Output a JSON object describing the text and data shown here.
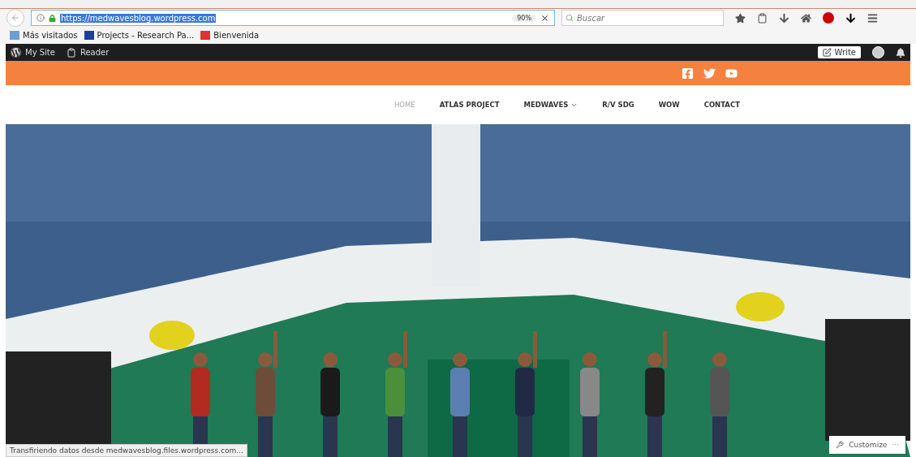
{
  "browser": {
    "url": "https://medwavesblog.wordpress.com",
    "zoom": "90%",
    "search": {
      "placeholder": "Buscar"
    },
    "bookmarks": [
      {
        "label": "Más visitados"
      },
      {
        "label": "Projects - Research Pa..."
      },
      {
        "label": "Bienvenida"
      }
    ]
  },
  "admin_bar": {
    "items": [
      {
        "label": "My Site"
      },
      {
        "label": "Reader"
      }
    ],
    "write": "Write"
  },
  "nav": [
    {
      "label": "HOME",
      "selected": true,
      "dropdown": false
    },
    {
      "label": "ATLAS PROJECT",
      "selected": false,
      "dropdown": false
    },
    {
      "label": "MEDWAVES",
      "selected": false,
      "dropdown": true
    },
    {
      "label": "R/V SDG",
      "selected": false,
      "dropdown": false
    },
    {
      "label": "WOW",
      "selected": false,
      "dropdown": false
    },
    {
      "label": "CONTACT",
      "selected": false,
      "dropdown": false
    }
  ],
  "status_bar": "Transfiriendo datos desde medwavesblog.files.wordpress.com...",
  "customize": {
    "label": "Customize",
    "more": "···"
  }
}
